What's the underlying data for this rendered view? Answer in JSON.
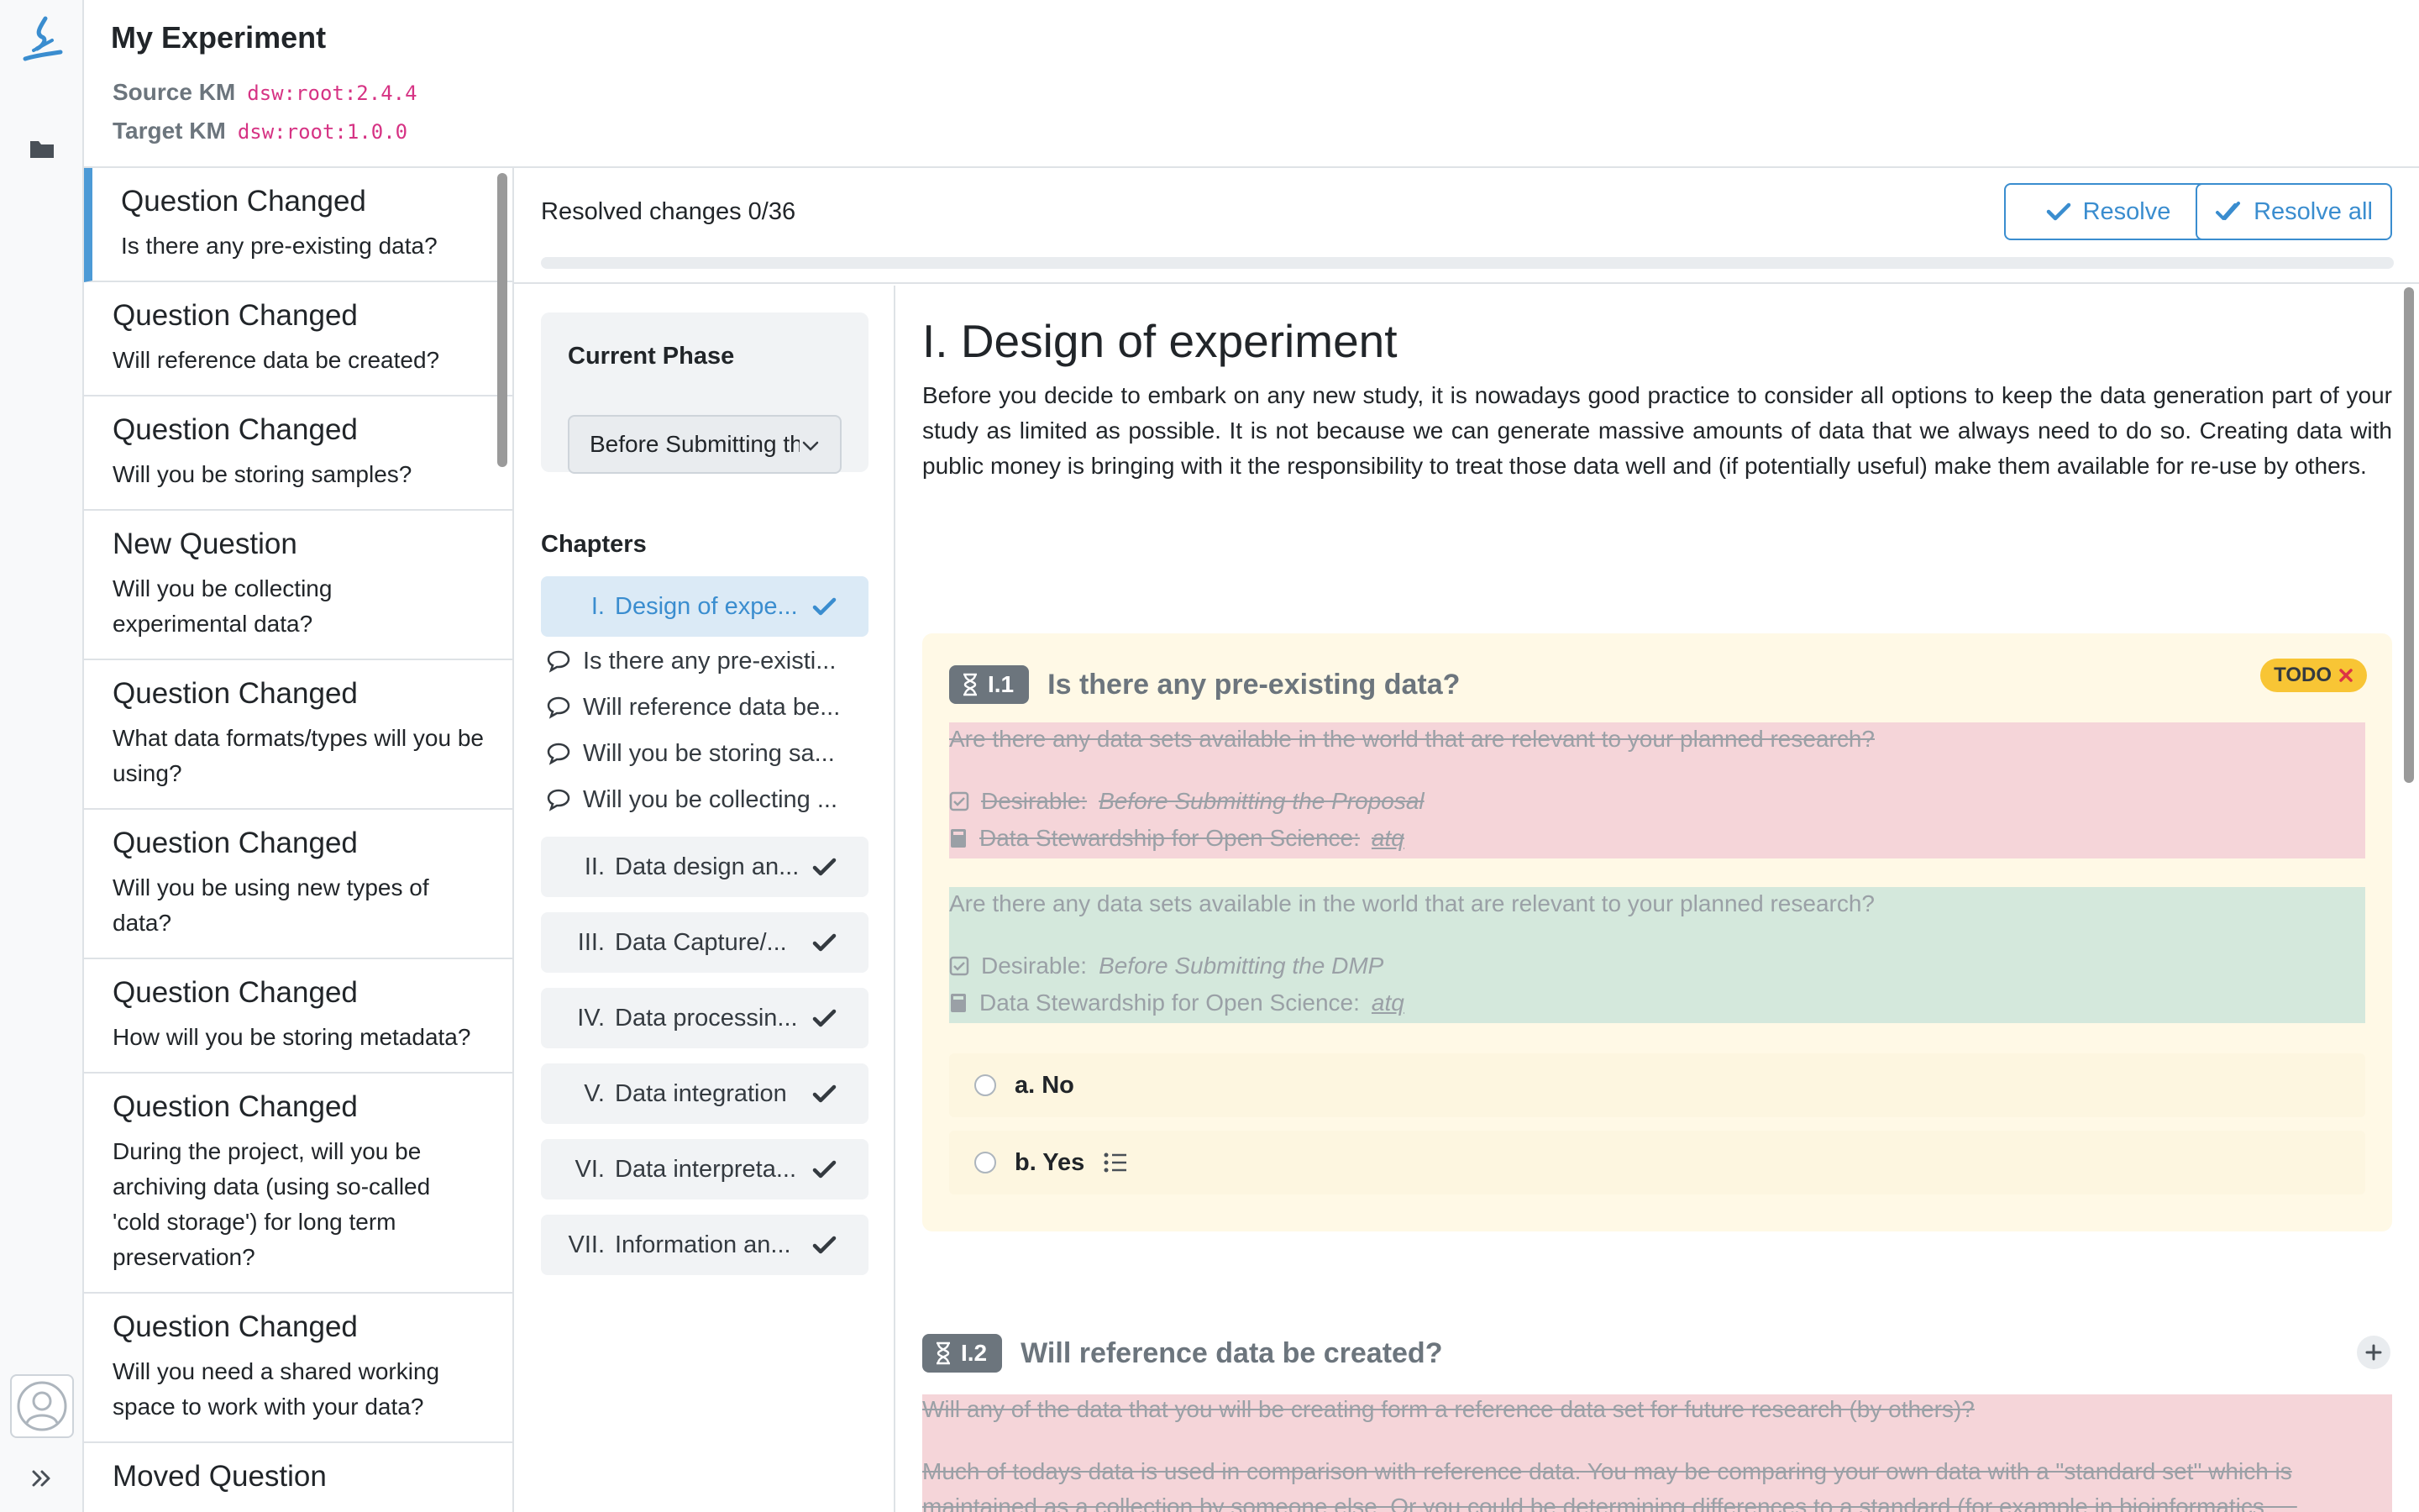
{
  "experiment": {
    "title": "My Experiment",
    "source_km_label": "Source KM",
    "source_km_value": "dsw:root:2.4.4",
    "target_km_label": "Target KM",
    "target_km_value": "dsw:root:1.0.0"
  },
  "changes": [
    {
      "type": "Question Changed",
      "text": "Is there any pre-existing data?"
    },
    {
      "type": "Question Changed",
      "text": "Will reference data be created?"
    },
    {
      "type": "Question Changed",
      "text": "Will you be storing samples?"
    },
    {
      "type": "New Question",
      "text": "Will you be collecting experimental data?"
    },
    {
      "type": "Question Changed",
      "text": "What data formats/types will you be using?"
    },
    {
      "type": "Question Changed",
      "text": "Will you be using new types of data?"
    },
    {
      "type": "Question Changed",
      "text": "How will you be storing metadata?"
    },
    {
      "type": "Question Changed",
      "text": "During the project, will you be archiving data (using so-called 'cold storage') for long term preservation?"
    },
    {
      "type": "Question Changed",
      "text": "Will you need a shared working space to work with your data?"
    },
    {
      "type": "Moved Question",
      "text": ""
    }
  ],
  "toolbar": {
    "resolved_text": "Resolved changes 0/36",
    "progress": 0,
    "resolve_label": "Resolve",
    "resolve_all_label": "Resolve all"
  },
  "phase": {
    "label": "Current Phase",
    "selected": "Before Submitting the DMP"
  },
  "chapters_title": "Chapters",
  "chapters": [
    {
      "num": "I.",
      "title": "Design of expe..."
    },
    {
      "num": "II.",
      "title": "Data design an..."
    },
    {
      "num": "III.",
      "title": "Data Capture/..."
    },
    {
      "num": "IV.",
      "title": "Data processin..."
    },
    {
      "num": "V.",
      "title": "Data integration"
    },
    {
      "num": "VI.",
      "title": "Data interpreta..."
    },
    {
      "num": "VII.",
      "title": "Information an..."
    }
  ],
  "chapter_questions": [
    "Is there any pre-existi...",
    "Will reference data be...",
    "Will you be storing sa...",
    "Will you be collecting ..."
  ],
  "content": {
    "heading": "I. Design of experiment",
    "intro": "Before you decide to embark on any new study, it is nowadays good practice to consider all options to keep the data generation part of your study as limited as possible. It is not because we can generate massive amounts of data that we always need to do so. Creating data with public money is bringing with it the responsibility to treat those data well and (if potentially useful) make them available for re-use by others.",
    "q1": {
      "number": "I.1",
      "title": "Is there any pre-existing data?",
      "todo": "TODO",
      "removed_text": "Are there any data sets available in the world that are relevant to your planned research?",
      "removed_desirable_label": "Desirable:",
      "removed_desirable_value": "Before Submitting the Proposal",
      "removed_ref_label": "Data Stewardship for Open Science:",
      "removed_ref_value": "atq",
      "added_text": "Are there any data sets available in the world that are relevant to your planned research?",
      "added_desirable_label": "Desirable:",
      "added_desirable_value": "Before Submitting the DMP",
      "added_ref_label": "Data Stewardship for Open Science:",
      "added_ref_value": "atq",
      "answer_a": "a. No",
      "answer_b": "b. Yes"
    },
    "q2": {
      "number": "I.2",
      "title": "Will reference data be created?",
      "removed_text": "Will any of the data that you will be creating form a reference data set for future research (by others)?",
      "removed_text2": "Much of todays data is used in comparison with reference data. You may be comparing your own data with a \"standard set\" which is",
      "removed_text3": "maintained as a collection by someone else. Or you could be determining differences to a standard (for example in bioinformatics, ..."
    }
  },
  "colors": {
    "accent": "#3a8dcf",
    "removed_bg": "#f5d5d9",
    "added_bg": "#d4e8dc",
    "question_bg": "#fff9e6",
    "todo": "#f8c535"
  }
}
